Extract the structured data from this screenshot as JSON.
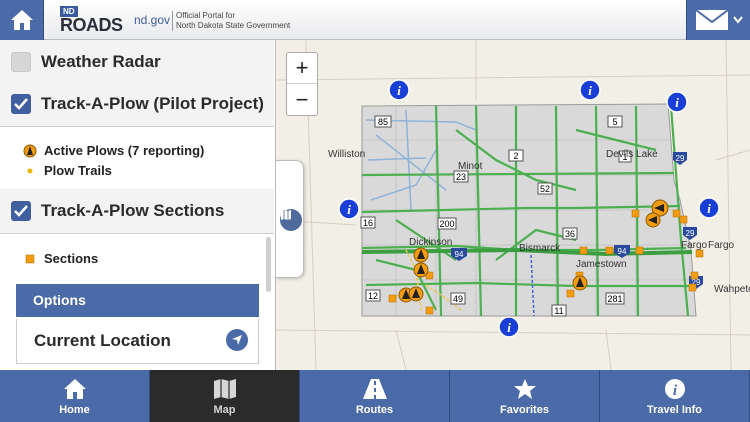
{
  "header": {
    "home_icon": "house-icon",
    "logo_badge": "ND",
    "logo_text": "ROADS",
    "logo_domain": "nd.gov",
    "portal_line1": "Official Portal for",
    "portal_line2": "North Dakota State Government",
    "mail_icon": "envelope-icon"
  },
  "sidebar": {
    "layers": [
      {
        "label": "Weather Radar",
        "checked": false
      },
      {
        "label": "Track-A-Plow (Pilot Project)",
        "checked": true
      },
      {
        "label": "Track-A-Plow Sections",
        "checked": true
      }
    ],
    "plow_legend": [
      {
        "label": "Active Plows (7 reporting)",
        "icon": "plow-marker-icon"
      },
      {
        "label": "Plow Trails",
        "icon": "trail-dot-icon"
      }
    ],
    "sections_legend": {
      "label": "Sections",
      "icon": "section-square-icon"
    },
    "options_label": "Options",
    "current_location_label": "Current Location"
  },
  "map": {
    "zoom_in": "+",
    "zoom_out": "−",
    "cities": [
      "Williston",
      "Minot",
      "Devils Lake",
      "Dickinson",
      "Bismarck",
      "Jamestown",
      "Fargo",
      "Fargo",
      "Wahpeton"
    ],
    "route_shields": [
      "85",
      "2",
      "5",
      "23",
      "52",
      "29",
      "16",
      "200",
      "36",
      "94",
      "94",
      "29",
      "12",
      "49",
      "281",
      "11",
      "29",
      "1"
    ],
    "colors": {
      "road_green": "#4caf50",
      "plow_orange": "#f39c12",
      "info_blue": "#1a3fd6",
      "state_fill": "#d9d9d9"
    }
  },
  "bottom_nav": [
    {
      "label": "Home",
      "icon": "house-icon",
      "active": false
    },
    {
      "label": "Map",
      "icon": "map-icon",
      "active": true
    },
    {
      "label": "Routes",
      "icon": "road-icon",
      "active": false
    },
    {
      "label": "Favorites",
      "icon": "star-icon",
      "active": false
    },
    {
      "label": "Travel Info",
      "icon": "info-icon",
      "active": false
    }
  ]
}
